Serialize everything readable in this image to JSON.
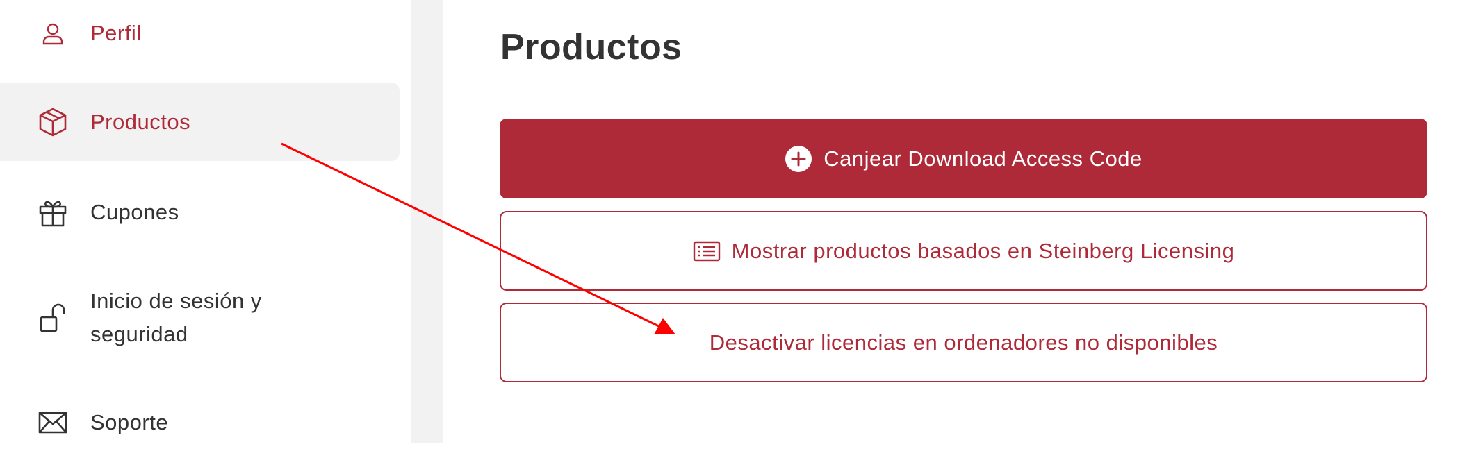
{
  "sidebar": {
    "items": [
      {
        "label": "Perfil",
        "icon": "person-icon"
      },
      {
        "label": "Productos",
        "icon": "package-icon"
      },
      {
        "label": "Cupones",
        "icon": "gift-icon"
      },
      {
        "label_line1": "Inicio de sesión y",
        "label_line2": "seguridad",
        "icon": "unlocked-padlock-icon"
      },
      {
        "label": "Soporte",
        "icon": "envelope-icon"
      }
    ]
  },
  "main": {
    "title": "Productos",
    "buttons": [
      {
        "label": "Canjear Download Access Code",
        "icon": "plus-circle-icon"
      },
      {
        "label": "Mostrar productos basados en Steinberg Licensing",
        "icon": "list-icon"
      },
      {
        "label": "Desactivar licencias en ordenadores no disponibles"
      }
    ]
  },
  "colors": {
    "accent": "#af2a38",
    "text_dark": "#333333",
    "active_bg": "#f2f2f2",
    "annotation_arrow": "#ff0000"
  }
}
